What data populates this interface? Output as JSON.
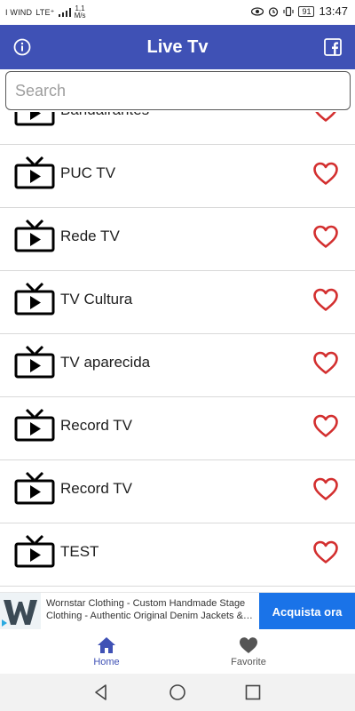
{
  "status_bar": {
    "carrier": "I WIND",
    "network_badge": "LTE⁺",
    "speed_value": "1,1",
    "speed_unit": "M/s",
    "battery": "91",
    "time": "13:47"
  },
  "app_bar": {
    "title": "Live Tv",
    "left_icon": "info-icon",
    "right_icon": "facebook-icon",
    "color": "#3f51b5"
  },
  "search": {
    "placeholder": "Search",
    "value": ""
  },
  "channels": [
    {
      "name": "Bandairantes",
      "favorite": false
    },
    {
      "name": "PUC TV",
      "favorite": false
    },
    {
      "name": "Rede TV",
      "favorite": false
    },
    {
      "name": "TV Cultura",
      "favorite": false
    },
    {
      "name": "TV aparecida",
      "favorite": false
    },
    {
      "name": "Record TV",
      "favorite": false
    },
    {
      "name": "Record TV",
      "favorite": false
    },
    {
      "name": "TEST",
      "favorite": false
    }
  ],
  "heart_color": "#d32f2f",
  "ad": {
    "text": "Wornstar Clothing - Custom Handmade Stage Clothing - Authentic Original Denim Jackets &…",
    "cta": "Acquista ora",
    "cta_color": "#1a73e8"
  },
  "bottom_nav": {
    "items": [
      {
        "label": "Home",
        "icon": "home-icon",
        "active": true
      },
      {
        "label": "Favorite",
        "icon": "heart-icon",
        "active": false
      }
    ]
  },
  "system_nav": {
    "buttons": [
      "back-icon",
      "home-circle-icon",
      "recent-apps-icon"
    ]
  }
}
